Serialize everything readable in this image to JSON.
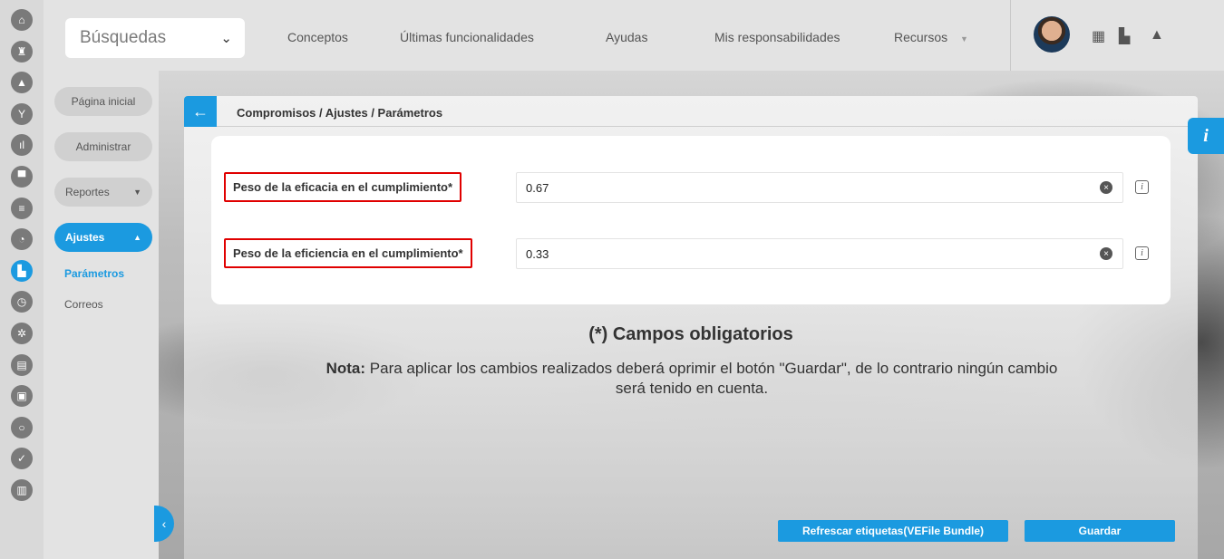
{
  "colors": {
    "accent": "#1b9ae0",
    "highlight_border": "#e00000"
  },
  "rail": {
    "icons": [
      {
        "name": "home-icon",
        "glyph": "⌂"
      },
      {
        "name": "castle-icon",
        "glyph": "♜"
      },
      {
        "name": "triangle-icon",
        "glyph": "▲"
      },
      {
        "name": "plant-icon",
        "glyph": "Y"
      },
      {
        "name": "bar-chart-icon",
        "glyph": "ıl"
      },
      {
        "name": "presentation-icon",
        "glyph": "▀"
      },
      {
        "name": "lines-icon",
        "glyph": "≡"
      },
      {
        "name": "pie-chart-icon",
        "glyph": "◔"
      },
      {
        "name": "map-icon",
        "glyph": "▙",
        "active": true
      },
      {
        "name": "clock-icon",
        "glyph": "◷"
      },
      {
        "name": "gear-icon",
        "glyph": "✲"
      },
      {
        "name": "document-icon",
        "glyph": "▤"
      },
      {
        "name": "lock-icon",
        "glyph": "▣"
      },
      {
        "name": "cycle-icon",
        "glyph": "○"
      },
      {
        "name": "check-icon",
        "glyph": "✓"
      },
      {
        "name": "briefcase-icon",
        "glyph": "▥"
      }
    ]
  },
  "topbar": {
    "search_label": "Búsquedas",
    "search_chevron": "⌄",
    "nav": [
      "Conceptos",
      "Últimas funcionalidades",
      "Ayudas",
      "Mis responsabilidades",
      "Recursos"
    ],
    "resources_caret": "▼",
    "icons": {
      "calendar": "▦",
      "map": "▙",
      "bell": "▲"
    }
  },
  "sidebar": {
    "home": "Página inicial",
    "admin": "Administrar",
    "reports": "Reportes",
    "reports_caret": "▼",
    "settings": "Ajustes",
    "settings_caret": "▲",
    "links": [
      "Parámetros",
      "Correos"
    ],
    "collapse": "‹"
  },
  "panel": {
    "back": "←",
    "breadcrumb": "Compromisos / Ajustes / Parámetros",
    "fields": [
      {
        "label": "Peso de la eficacia en el cumplimiento*",
        "value": "0.67"
      },
      {
        "label": "Peso de la eficiencia en el cumplimiento*",
        "value": "0.33"
      }
    ],
    "clear_glyph": "×",
    "info_glyph": "i",
    "required_title": "(*) Campos obligatorios",
    "note_bold": "Nota:",
    "note_text": " Para aplicar los cambios realizados deberá oprimir el botón \"Guardar\", de lo contrario ningún cambio será tenido en cuenta.",
    "refresh_button": "Refrescar etiquetas(VEFile Bundle)",
    "save_button": "Guardar"
  },
  "info_tab": "i"
}
